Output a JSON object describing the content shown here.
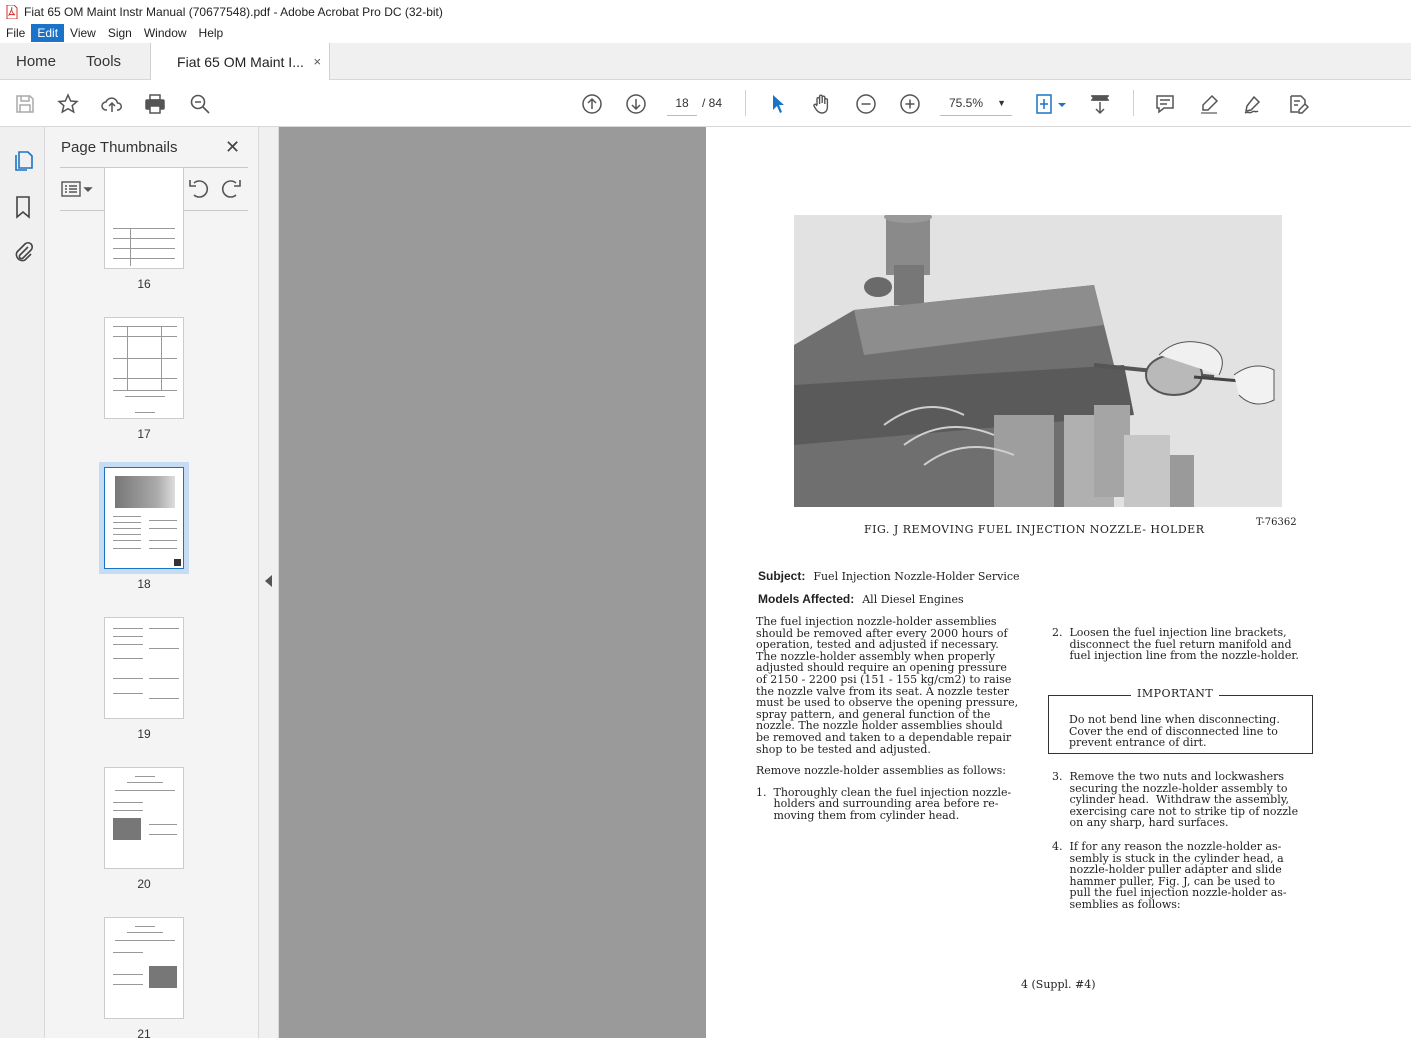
{
  "window": {
    "title": "Fiat 65 OM Maint Instr Manual (70677548).pdf - Adobe Acrobat Pro DC (32-bit)"
  },
  "menu": [
    "File",
    "Edit",
    "Sign",
    "Window",
    "Help"
  ],
  "tabs": {
    "home": "Home",
    "tools": "Tools",
    "document": "Fiat 65 OM Maint I...",
    "close": "×"
  },
  "toolbar": {
    "page_current": "18",
    "page_total": "/ 84",
    "zoom": "75.5%"
  },
  "thumbnails": {
    "title": "Page Thumbnails",
    "close": "✕",
    "pages": [
      "16",
      "17",
      "18",
      "19",
      "20",
      "21"
    ],
    "selected": "18"
  },
  "document": {
    "caption": "FIG. J REMOVING FUEL INJECTION NOZZLE- HOLDER",
    "figure_number": "T-76362",
    "subject_label": "Subject:",
    "subject_value": "Fuel Injection Nozzle-Holder Service",
    "models_label": "Models Affected:",
    "models_value": "All Diesel Engines",
    "left_para1": "The fuel injection nozzle-holder assemblies\nshould be removed after every 2000 hours of\noperation, tested and adjusted if necessary.\nThe nozzle-holder assembly when properly\nadjusted should require an opening pressure\nof 2150 - 2200 psi (151 - 155 kg/cm2) to raise\nthe nozzle valve from its seat. A nozzle tester\nmust be used to observe the opening pressure,\nspray pattern, and general function of the\nnozzle. The nozzle holder assemblies should\nbe removed and taken to a dependable repair\nshop to be tested and adjusted.",
    "left_para2": "Remove nozzle-holder assemblies as follows:",
    "left_step1": "1.  Thoroughly clean the fuel injection nozzle-\n     holders and surrounding area before re-\n     moving them from cylinder head.",
    "right_step2": "2.  Loosen the fuel injection line brackets,\n     disconnect the fuel return manifold and\n     fuel injection line from the nozzle-holder.",
    "important_title": "IMPORTANT",
    "important_body": "Do not bend line when disconnecting.\nCover the end of disconnected line to\nprevent entrance of dirt.",
    "right_step3": "3.  Remove the two nuts and lockwashers\n     securing the nozzle-holder assembly to\n     cylinder head.  Withdraw the assembly,\n     exercising care not to strike tip of nozzle\n     on any sharp, hard surfaces.",
    "right_step4": "4.  If for any reason the nozzle-holder as-\n     sembly is stuck in the cylinder head, a\n     nozzle-holder puller adapter and slide\n     hammer puller, Fig. J, can be used to\n     pull the fuel injection nozzle-holder as-\n     semblies as follows:",
    "page_footer": "4  (Suppl. #4)"
  }
}
